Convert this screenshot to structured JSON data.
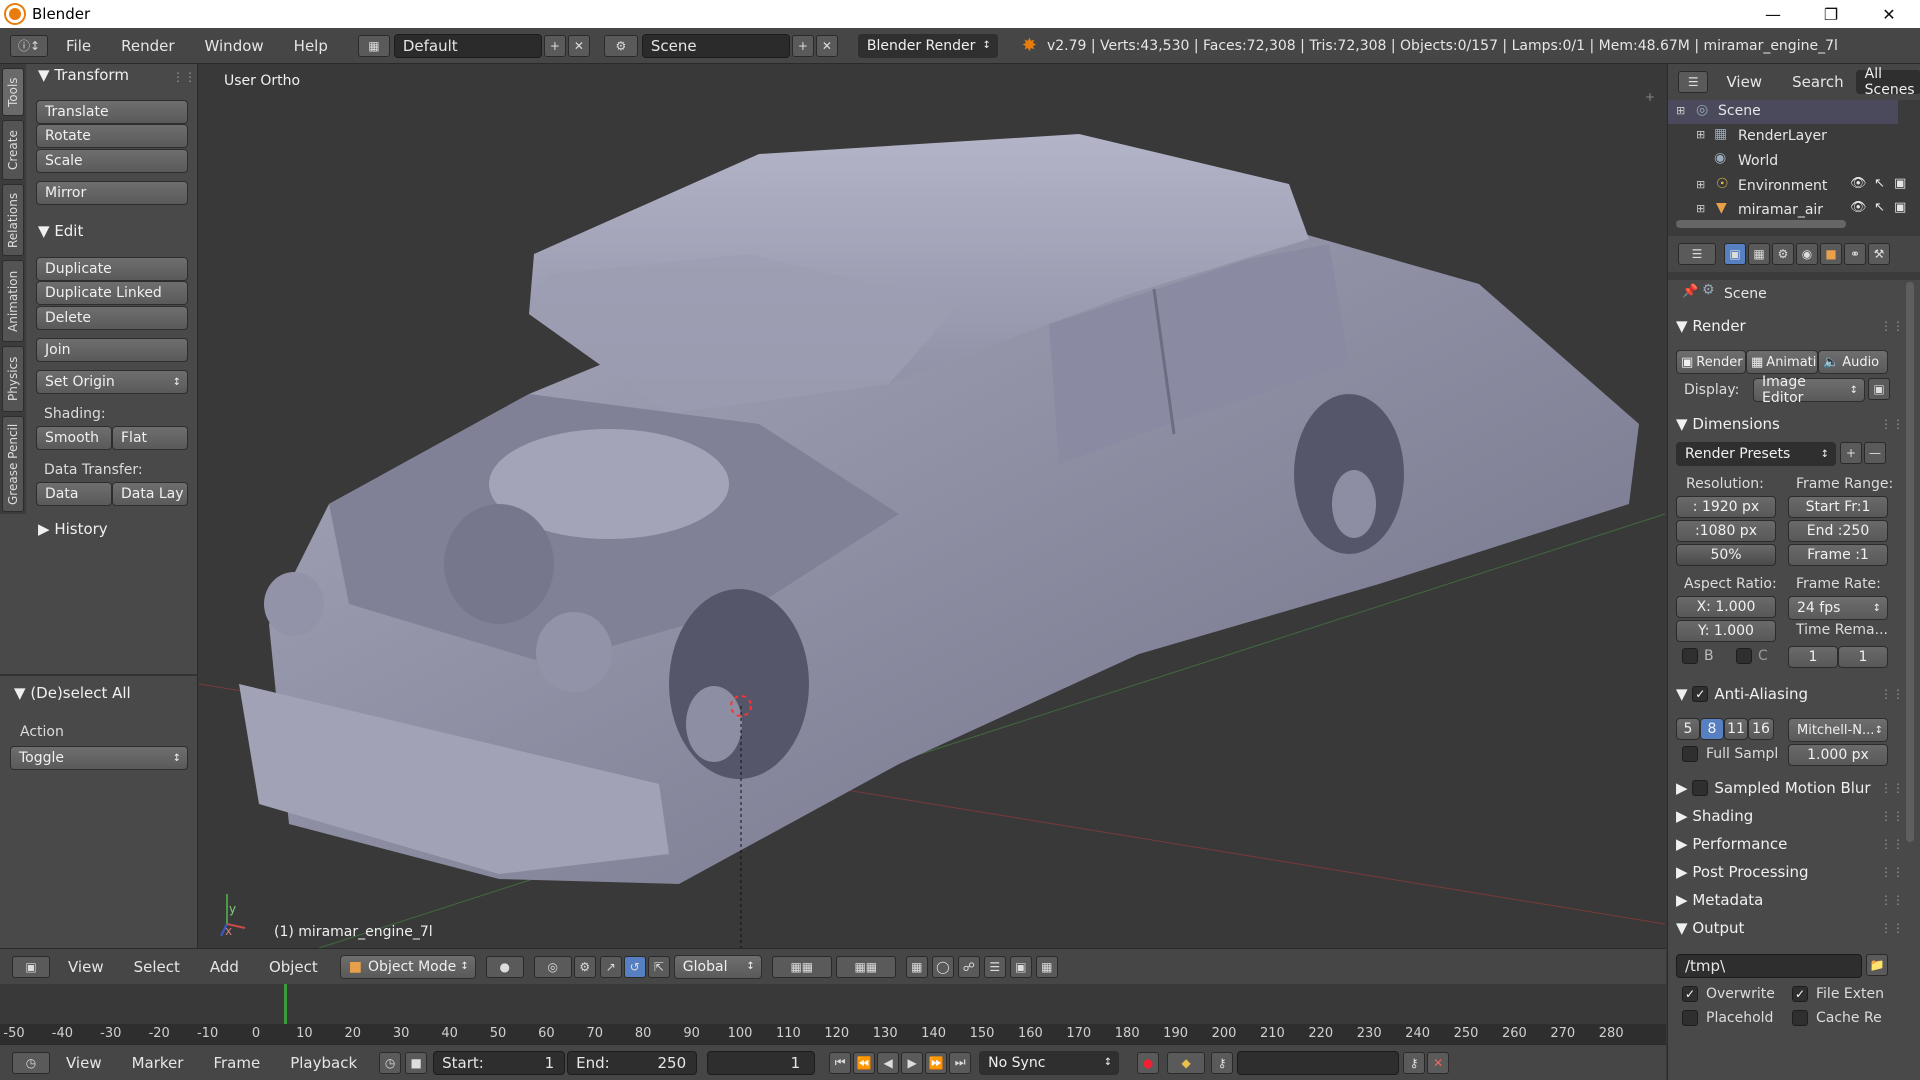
{
  "window": {
    "title": "Blender"
  },
  "info_bar": {
    "menus": [
      "File",
      "Render",
      "Window",
      "Help"
    ],
    "screen_layout": "Default",
    "scene": "Scene",
    "render_engine": "Blender Render",
    "stats": "v2.79 | Verts:43,530 | Faces:72,308 | Tris:72,308 | Objects:0/157 | Lamps:0/1 | Mem:48.67M | miramar_engine_7l"
  },
  "tabs_vertical": [
    "Tools",
    "Create",
    "Relations",
    "Animation",
    "Physics",
    "Grease Pencil"
  ],
  "tool_shelf": {
    "transform": {
      "title": "Transform",
      "buttons": [
        "Translate",
        "Rotate",
        "Scale",
        "Mirror"
      ]
    },
    "edit": {
      "title": "Edit",
      "buttons": [
        "Duplicate",
        "Duplicate Linked",
        "Delete",
        "Join"
      ],
      "set_origin": "Set Origin",
      "shading_label": "Shading:",
      "smooth": "Smooth",
      "flat": "Flat",
      "data_transfer_label": "Data Transfer:",
      "data": "Data",
      "data_lay": "Data Lay"
    },
    "history": {
      "title": "History"
    },
    "operator": {
      "title": "(De)select All",
      "action_label": "Action",
      "action_value": "Toggle"
    }
  },
  "viewport": {
    "view_name": "User Ortho",
    "object_label": "(1) miramar_engine_7l",
    "axis_y": "y",
    "axis_x": "x"
  },
  "viewport_header": {
    "menus": [
      "View",
      "Select",
      "Add",
      "Object"
    ],
    "mode": "Object Mode",
    "orientation": "Global"
  },
  "timeline": {
    "ticks": [
      "-50",
      "-40",
      "-30",
      "-20",
      "-10",
      "0",
      "10",
      "20",
      "30",
      "40",
      "50",
      "60",
      "70",
      "80",
      "90",
      "100",
      "110",
      "120",
      "130",
      "140",
      "150",
      "160",
      "170",
      "180",
      "190",
      "200",
      "210",
      "220",
      "230",
      "240",
      "250",
      "260",
      "270",
      "280"
    ]
  },
  "time_bar": {
    "menus": [
      "View",
      "Marker",
      "Frame",
      "Playback"
    ],
    "start_label": "Start:",
    "start": "1",
    "end_label": "End:",
    "end": "250",
    "current": "1",
    "sync": "No Sync"
  },
  "outliner": {
    "menus": [
      "View",
      "Search"
    ],
    "filter": "All Scenes",
    "items": [
      "Scene",
      "RenderLayer",
      "World",
      "Environment",
      "miramar_air"
    ]
  },
  "properties": {
    "context": "Scene",
    "render": {
      "title": "Render",
      "buttons": [
        "Render",
        "Animati",
        "Audio"
      ],
      "display_label": "Display:",
      "display_value": "Image Editor"
    },
    "dimensions": {
      "title": "Dimensions",
      "presets": "Render Presets",
      "resolution_label": "Resolution:",
      "res_x": ": 1920 px",
      "res_y": ":1080 px",
      "res_pct": "50%",
      "frame_range_label": "Frame Range:",
      "start": "Start Fr:1",
      "end": "End :250",
      "frame": "Frame :1",
      "aspect_label": "Aspect Ratio:",
      "aspect_x": "X:  1.000",
      "aspect_y": "Y:  1.000",
      "frame_rate_label": "Frame Rate:",
      "fps": "24 fps",
      "time_remap": "Time Rema...",
      "b": "B",
      "c": "C",
      "remap_old": "1",
      "remap_new": "1"
    },
    "anti_aliasing": {
      "title": "Anti-Aliasing",
      "samples": [
        "5",
        "8",
        "11",
        "16"
      ],
      "filter": "Mitchell-N...",
      "full_sample": "Full Sampl",
      "filter_size": "1.000 px"
    },
    "collapsed": [
      "Sampled Motion Blur",
      "Shading",
      "Performance",
      "Post Processing",
      "Metadata"
    ],
    "output": {
      "title": "Output",
      "path": "/tmp\\",
      "overwrite": "Overwrite",
      "file_ext": "File Exten",
      "placeholder": "Placehold",
      "cache": "Cache Re"
    }
  }
}
